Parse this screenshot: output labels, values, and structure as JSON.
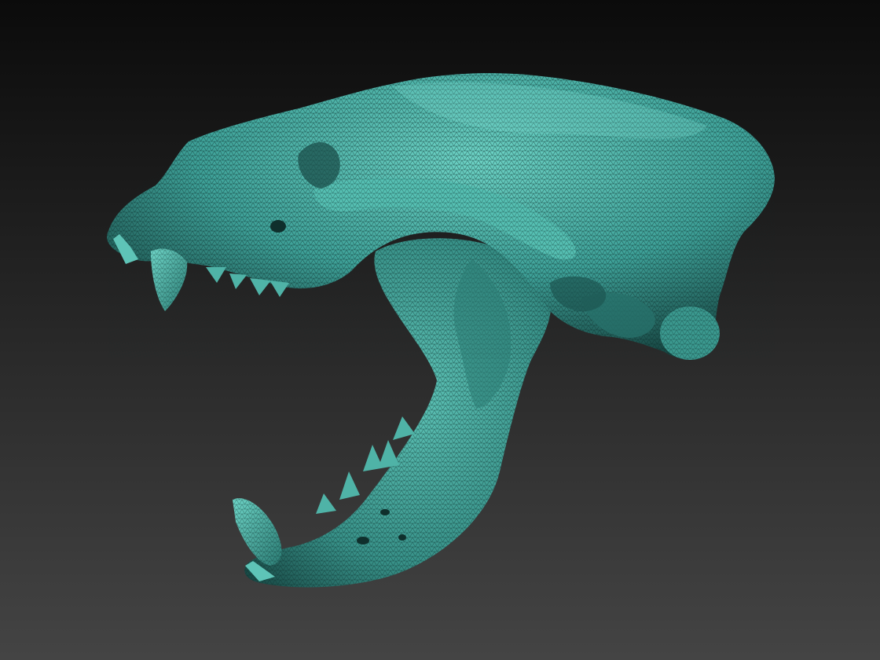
{
  "viewport": {
    "background_top": "#0b0b0b",
    "background_bottom": "#444444"
  },
  "model": {
    "surface_color": "#3fa39a",
    "highlight_color": "#6fd6c8",
    "shadow_color": "#123a37",
    "wire_color": "#0c2c2a",
    "render_mode": "polyframe-mesh"
  }
}
